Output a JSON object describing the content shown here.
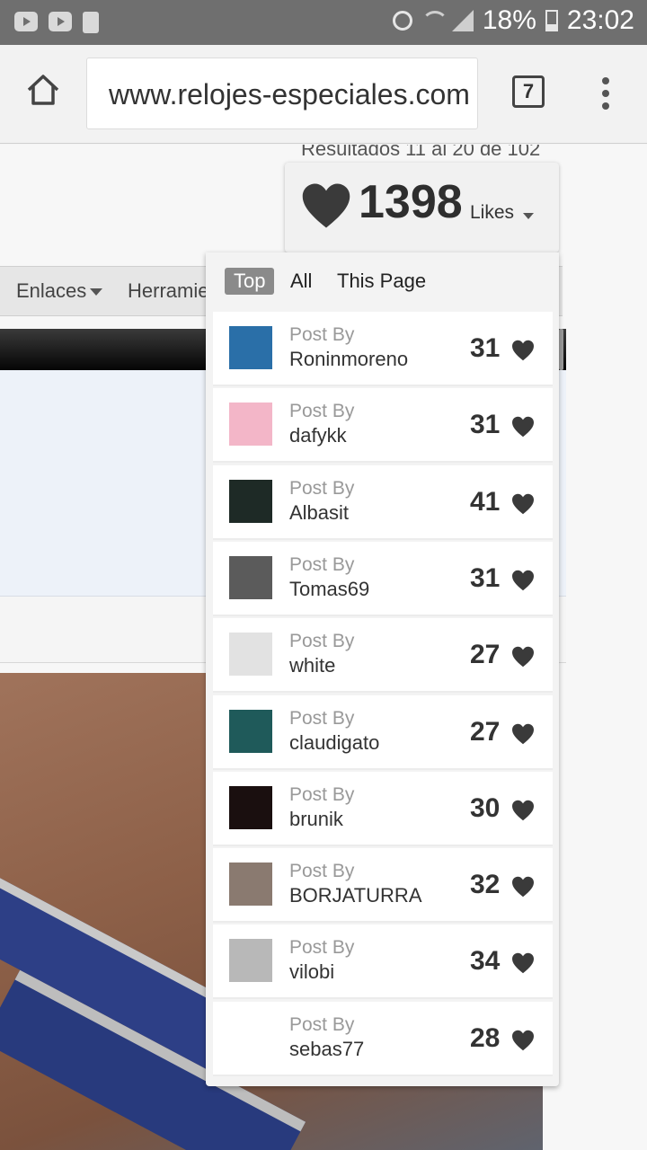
{
  "status_bar": {
    "battery": "18%",
    "time": "23:02"
  },
  "browser": {
    "url": "www.relojes-especiales.com",
    "tab_count": "7"
  },
  "page": {
    "results_text": "Resultados 11 al 20 de 102",
    "nav": [
      "Enlaces",
      "Herramie"
    ]
  },
  "likes": {
    "total": "1398",
    "label": "Likes",
    "tabs": [
      "Top",
      "All",
      "This Page"
    ],
    "active_tab": "Top",
    "post_by_label": "Post By",
    "entries": [
      {
        "user": "Roninmoreno",
        "count": "31",
        "avatar_color": "#2a6fa8"
      },
      {
        "user": "dafykk",
        "count": "31",
        "avatar_color": "#f3b6c8"
      },
      {
        "user": "Albasit",
        "count": "41",
        "avatar_color": "#1e2a26"
      },
      {
        "user": "Tomas69",
        "count": "31",
        "avatar_color": "#5b5b5b"
      },
      {
        "user": "white",
        "count": "27",
        "avatar_color": "#e2e2e2"
      },
      {
        "user": "claudigato",
        "count": "27",
        "avatar_color": "#1f5a5a"
      },
      {
        "user": "brunik",
        "count": "30",
        "avatar_color": "#1a0f0f"
      },
      {
        "user": "BORJATURRA",
        "count": "32",
        "avatar_color": "#8a7a70"
      },
      {
        "user": "vilobi",
        "count": "34",
        "avatar_color": "#b8b8b8"
      },
      {
        "user": "sebas77",
        "count": "28",
        "avatar_color": "#ffffff"
      }
    ]
  },
  "colors": {
    "heart": "#3a3a3a",
    "status_bar": "#6f6f6f",
    "active_tab": "#8a8a8a"
  }
}
